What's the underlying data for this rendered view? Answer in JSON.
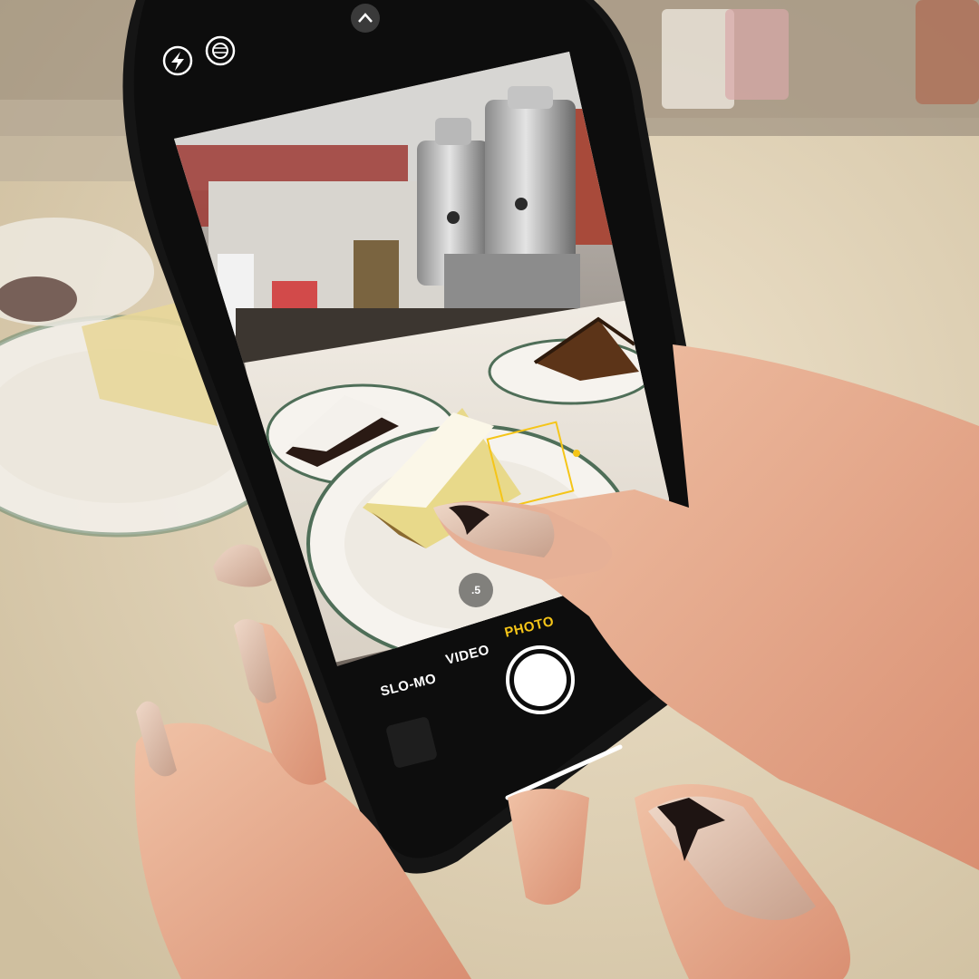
{
  "camera_ui": {
    "flash_icon": "flash-icon",
    "live_icon": "live-photo-icon",
    "chevron_icon": "chevron-up-icon",
    "flip_icon": "camera-flip-icon",
    "zoom_label": ".5",
    "modes": [
      {
        "label": "SLO-MO",
        "active": false
      },
      {
        "label": "VIDEO",
        "active": false
      },
      {
        "label": "PHOTO",
        "active": true
      }
    ],
    "active_color": "#f5c518",
    "inactive_color": "#ffffff"
  }
}
